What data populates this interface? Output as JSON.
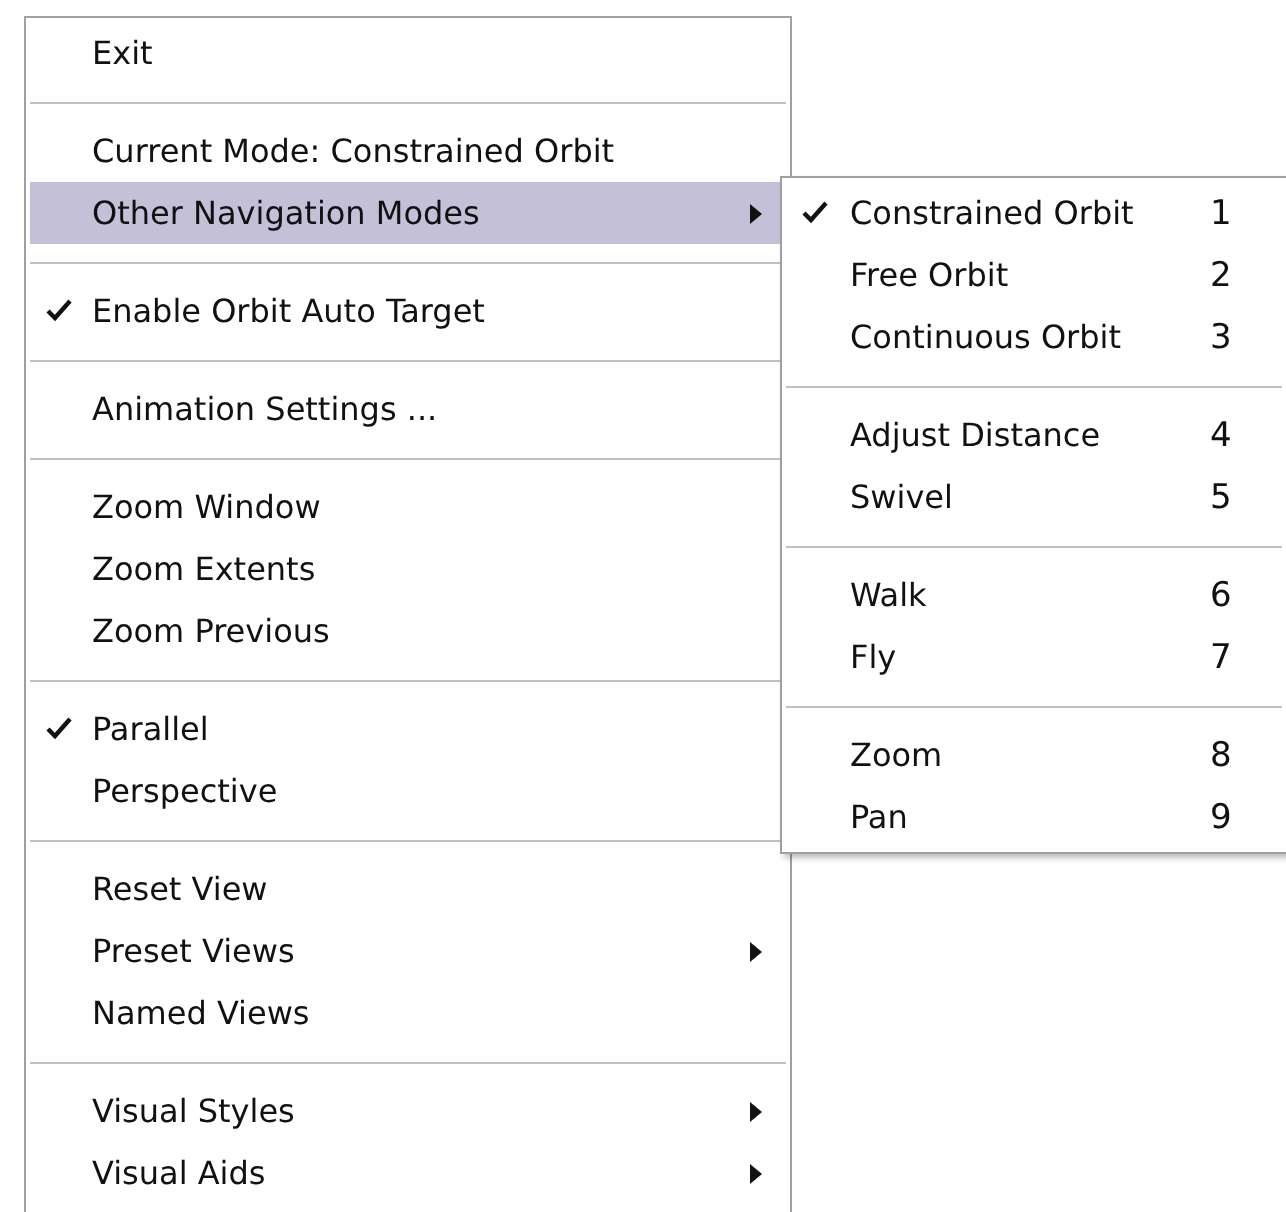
{
  "menu": {
    "items": [
      {
        "kind": "item",
        "label": "Exit",
        "checked": false,
        "has_submenu": false,
        "selected": false
      },
      {
        "kind": "separator"
      },
      {
        "kind": "item",
        "label": "Current Mode: Constrained Orbit",
        "checked": false,
        "has_submenu": false,
        "selected": false
      },
      {
        "kind": "item",
        "label": "Other Navigation Modes",
        "checked": false,
        "has_submenu": true,
        "selected": true
      },
      {
        "kind": "separator"
      },
      {
        "kind": "item",
        "label": "Enable Orbit Auto Target",
        "checked": true,
        "has_submenu": false,
        "selected": false
      },
      {
        "kind": "separator"
      },
      {
        "kind": "item",
        "label": "Animation Settings ...",
        "checked": false,
        "has_submenu": false,
        "selected": false
      },
      {
        "kind": "separator"
      },
      {
        "kind": "item",
        "label": "Zoom Window",
        "checked": false,
        "has_submenu": false,
        "selected": false
      },
      {
        "kind": "item",
        "label": "Zoom Extents",
        "checked": false,
        "has_submenu": false,
        "selected": false
      },
      {
        "kind": "item",
        "label": "Zoom Previous",
        "checked": false,
        "has_submenu": false,
        "selected": false
      },
      {
        "kind": "separator"
      },
      {
        "kind": "item",
        "label": "Parallel",
        "checked": true,
        "has_submenu": false,
        "selected": false
      },
      {
        "kind": "item",
        "label": "Perspective",
        "checked": false,
        "has_submenu": false,
        "selected": false
      },
      {
        "kind": "separator"
      },
      {
        "kind": "item",
        "label": "Reset View",
        "checked": false,
        "has_submenu": false,
        "selected": false
      },
      {
        "kind": "item",
        "label": "Preset Views",
        "checked": false,
        "has_submenu": true,
        "selected": false
      },
      {
        "kind": "item",
        "label": "Named Views",
        "checked": false,
        "has_submenu": false,
        "selected": false
      },
      {
        "kind": "separator"
      },
      {
        "kind": "item",
        "label": "Visual Styles",
        "checked": false,
        "has_submenu": true,
        "selected": false
      },
      {
        "kind": "item",
        "label": "Visual Aids",
        "checked": false,
        "has_submenu": true,
        "selected": false
      }
    ]
  },
  "submenu": {
    "items": [
      {
        "kind": "item",
        "label": "Constrained Orbit",
        "shortcut": "1",
        "checked": true
      },
      {
        "kind": "item",
        "label": "Free Orbit",
        "shortcut": "2",
        "checked": false
      },
      {
        "kind": "item",
        "label": "Continuous Orbit",
        "shortcut": "3",
        "checked": false
      },
      {
        "kind": "separator"
      },
      {
        "kind": "item",
        "label": "Adjust Distance",
        "shortcut": "4",
        "checked": false
      },
      {
        "kind": "item",
        "label": "Swivel",
        "shortcut": "5",
        "checked": false
      },
      {
        "kind": "separator"
      },
      {
        "kind": "item",
        "label": "Walk",
        "shortcut": "6",
        "checked": false
      },
      {
        "kind": "item",
        "label": "Fly",
        "shortcut": "7",
        "checked": false
      },
      {
        "kind": "separator"
      },
      {
        "kind": "item",
        "label": "Zoom",
        "shortcut": "8",
        "checked": false
      },
      {
        "kind": "item",
        "label": "Pan",
        "shortcut": "9",
        "checked": false
      }
    ]
  }
}
